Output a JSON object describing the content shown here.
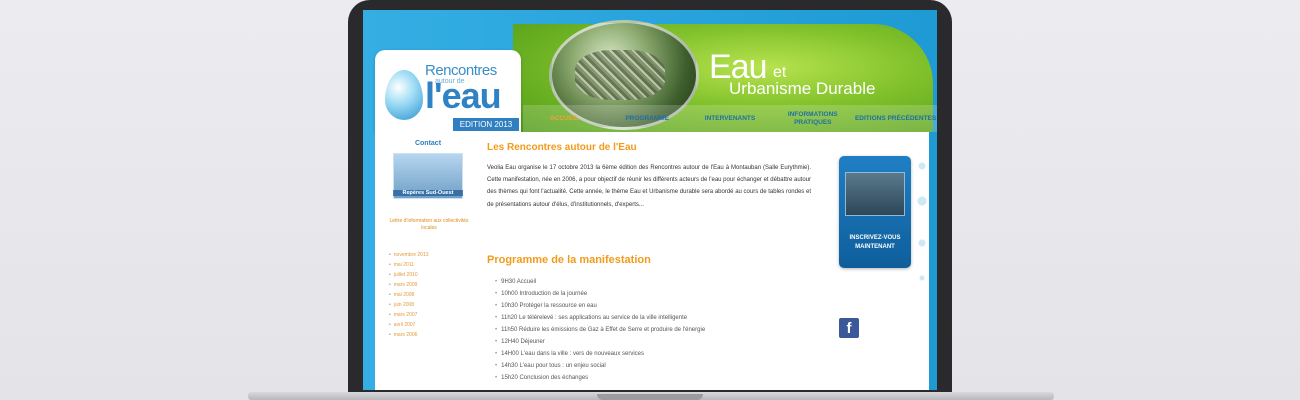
{
  "header": {
    "logo_top": "Rencontres",
    "logo_mid": "autour de",
    "logo_big": "l'eau",
    "edition": "EDITION 2013",
    "title_eau": "Eau",
    "title_et": "et",
    "title_sub": "Urbanisme Durable"
  },
  "nav": {
    "items": [
      {
        "label": "ACCUEIL"
      },
      {
        "label": "PROGRAMME"
      },
      {
        "label": "INTERVENANTS"
      },
      {
        "label": "INFORMATIONS PRATIQUES"
      },
      {
        "label": "EDITIONS PRÉCÉDENTES"
      }
    ]
  },
  "sidebar": {
    "contact": "Contact",
    "thumb_caption": "Repères Sud-Ouest",
    "note": "Lettre d'information aux collectivités locales",
    "archive": [
      "novembre 2013",
      "mai 2011",
      "juillet 2010",
      "mars 2009",
      "mai 2008",
      "juin 2008",
      "mars 2007",
      "avril 2007",
      "mars 2006"
    ]
  },
  "main": {
    "title": "Les Rencontres autour de l'Eau",
    "paragraph": "Veolia Eau organise le 17 octobre 2013 la 6ème édition des Rencontres autour de l'Eau à Montauban (Salle Eurythmie). Cette manifestation, née en 2006, a pour objectif de réunir les différents acteurs de l'eau pour échanger et débattre autour des thèmes qui font l'actualité. Cette année, le thème Eau et Urbanisme durable sera abordé au cours de tables rondes et de présentations autour d'élus, d'institutionnels, d'experts...",
    "program_title": "Programme de la manifestation",
    "program": [
      "9H30 Accueil",
      "10h00 Introduction de la journée",
      "10h30 Protéger la ressource en eau",
      "11h20 Le télérelevé : ses applications au service de la ville intelligente",
      "11h50 Réduire les émissions de Gaz à Effet de Serre et produire de l'énergie",
      "12H40 Déjeuner",
      "14H00 L'eau dans la ville : vers de nouveaux services",
      "14h30 L'eau pour tous : un enjeu social",
      "15h20 Conclusion des échanges"
    ]
  },
  "right": {
    "inscribe_label": "INSCRIVEZ-VOUS MAINTENANT",
    "facebook_glyph": "f"
  }
}
